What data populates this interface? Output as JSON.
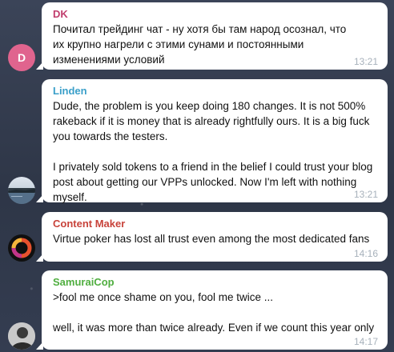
{
  "messages": [
    {
      "sender": "DK",
      "name_color": "#c03d6d",
      "avatar_letter": "D",
      "avatar_color": "#e0648e",
      "text": "Почитал трейдинг чат - ну хотя бы там народ осознал, что их крупно нагрели с этими сунами и постоянными изменениями условий",
      "time": "13:21"
    },
    {
      "sender": "Linden",
      "name_color": "#3a9fc9",
      "avatar_icon": "lake-landscape-photo",
      "text": "Dude, the problem is you keep doing 180 changes. It is not 500% rakeback if it is money that is already rightfully ours. It is a big fuck you towards the testers.\n\nI privately sold tokens to a friend in the belief I could trust your blog post about getting our VPPs unlocked. Now I'm left with nothing myself.",
      "time": "13:21"
    },
    {
      "sender": "Content Maker",
      "name_color": "#c8433b",
      "avatar_icon": "rainbow-ring-logo",
      "text": "Virtue poker has lost all trust even among the most dedicated fans",
      "time": "14:16"
    },
    {
      "sender": "SamuraiCop",
      "name_color": "#4fae3f",
      "avatar_icon": "person-photo-grayscale",
      "text": ">fool me once shame on you, fool me twice ...\n\nwell, it was more than twice already. Even if we count this year only",
      "time": "14:17"
    }
  ]
}
